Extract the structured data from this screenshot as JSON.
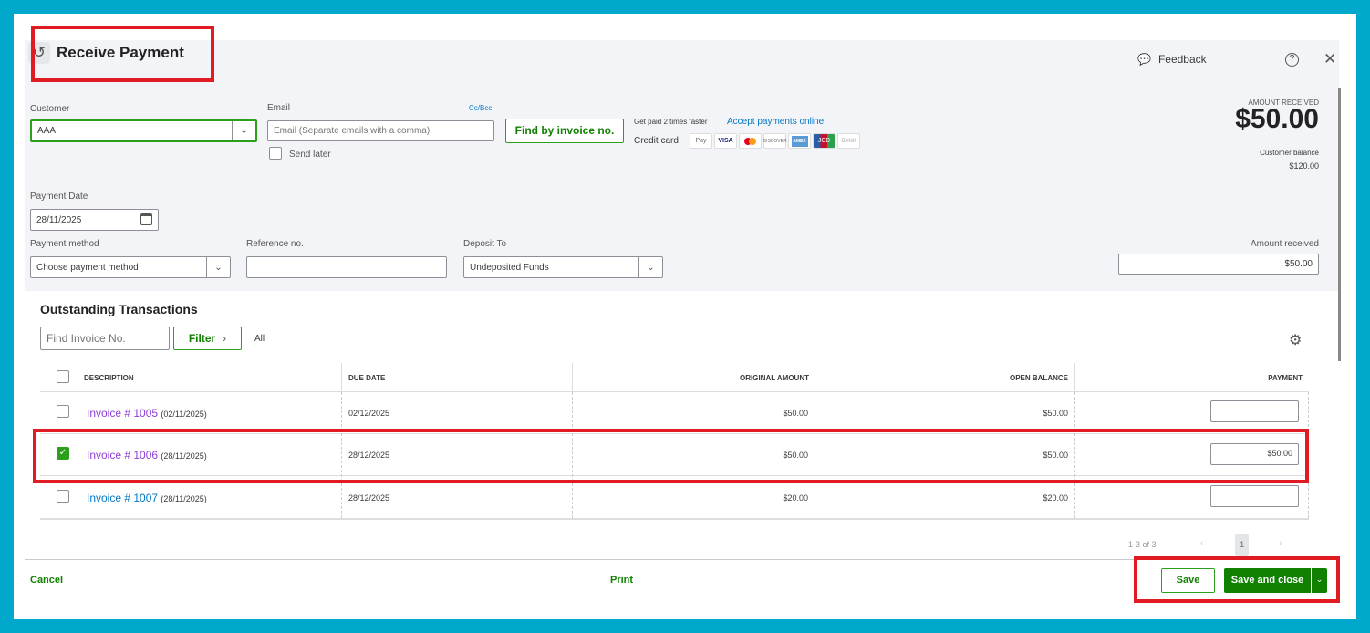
{
  "header": {
    "title": "Receive Payment",
    "feedback": "Feedback"
  },
  "form": {
    "customer_label": "Customer",
    "customer_value": "AAA",
    "email_label": "Email",
    "cc_bcc": "Cc/Bcc",
    "email_placeholder": "Email (Separate emails with a comma)",
    "send_later": "Send later",
    "find_by_invoice": "Find by invoice no.",
    "promo_text": "Get paid 2 times faster",
    "accept_online": "Accept payments online",
    "credit_card_label": "Credit card",
    "cards": [
      "Pay",
      "VISA",
      "MC",
      "DISCOVER",
      "AMEX",
      "JCB",
      "BANK"
    ],
    "amount_received_caption": "AMOUNT RECEIVED",
    "amount_received_big": "$50.00",
    "customer_balance_label": "Customer balance",
    "customer_balance": "$120.00",
    "payment_date_label": "Payment Date",
    "payment_date": "28/11/2025",
    "payment_method_label": "Payment method",
    "payment_method_value": "Choose payment method",
    "reference_label": "Reference no.",
    "reference_value": "",
    "deposit_to_label": "Deposit To",
    "deposit_to_value": "Undeposited Funds",
    "amount_received_label": "Amount received",
    "amount_received_value": "$50.00"
  },
  "outstanding": {
    "title": "Outstanding Transactions",
    "find_placeholder": "Find Invoice No.",
    "filter": "Filter",
    "filter_value": "All",
    "columns": [
      "DESCRIPTION",
      "DUE DATE",
      "ORIGINAL AMOUNT",
      "OPEN BALANCE",
      "PAYMENT"
    ],
    "rows": [
      {
        "invoice": "Invoice # 1005",
        "date": "(02/11/2025)",
        "due": "02/12/2025",
        "original": "$50.00",
        "open": "$50.00",
        "payment": "",
        "checked": false
      },
      {
        "invoice": "Invoice # 1006",
        "date": "(28/11/2025)",
        "due": "28/12/2025",
        "original": "$50.00",
        "open": "$50.00",
        "payment": "$50.00",
        "checked": true
      },
      {
        "invoice": "Invoice # 1007",
        "date": "(28/11/2025)",
        "due": "28/12/2025",
        "original": "$20.00",
        "open": "$20.00",
        "payment": "",
        "checked": false
      }
    ],
    "pagination": {
      "range": "1-3 of 3",
      "page": "1"
    }
  },
  "footer": {
    "cancel": "Cancel",
    "print": "Print",
    "save": "Save",
    "save_and_close": "Save and close"
  },
  "colors": {
    "accent": "#108000",
    "frame": "#00a8cc",
    "annotation": "#e11b22"
  }
}
